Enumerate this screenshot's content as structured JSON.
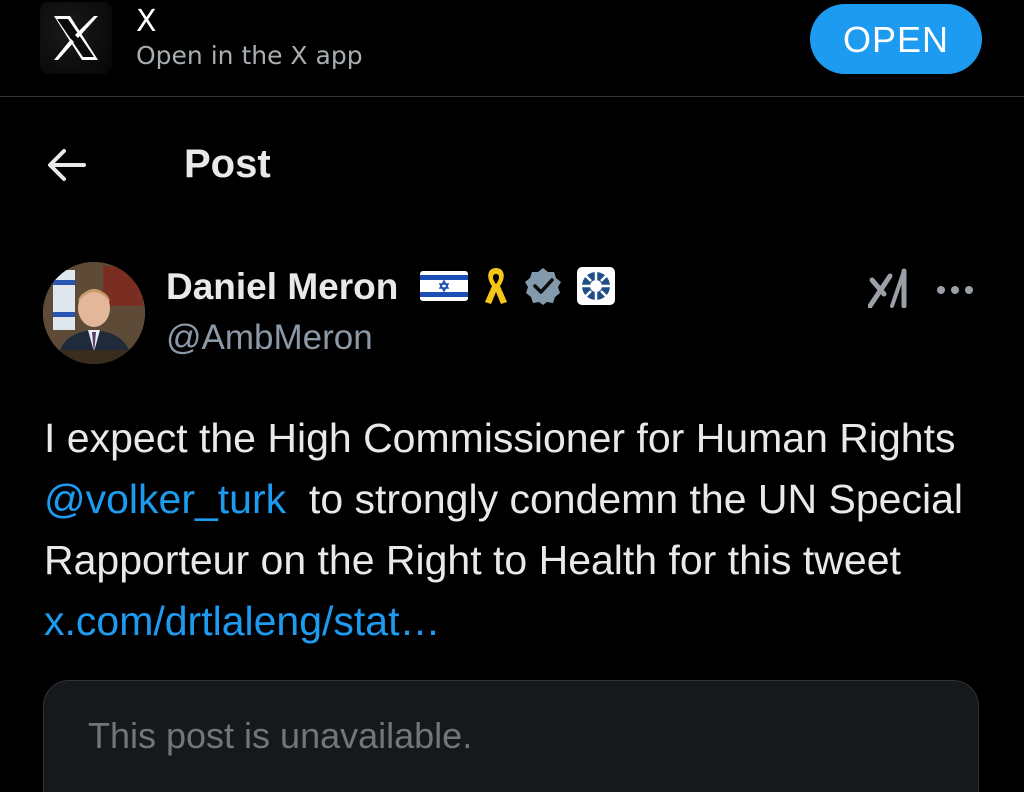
{
  "banner": {
    "app_name": "X",
    "subtitle": "Open in the X app",
    "open_label": "OPEN"
  },
  "header": {
    "title": "Post"
  },
  "author": {
    "name": "Daniel Meron",
    "handle": "@AmbMeron"
  },
  "post": {
    "text_1": "I expect the High Commissioner for Human Rights ",
    "mention": "@volker_turk",
    "text_2": "  to strongly condemn the UN Special Rapporteur on the Right to Health for this tweet ",
    "link": "x.com/drtlaleng/stat…"
  },
  "quoted": {
    "unavailable_text": "This post is unavailable."
  },
  "icons": {
    "app": "x-logo-icon",
    "back": "arrow-left-icon",
    "flag": "israel-flag-icon",
    "ribbon": "yellow-ribbon-icon",
    "verified": "verified-badge-icon",
    "affiliate": "affiliate-badge-icon",
    "grok": "grok-icon",
    "more": "more-icon"
  },
  "colors": {
    "background": "#000000",
    "accent": "#1d9bf0",
    "text": "#e7e9ea",
    "muted": "#8b98a5",
    "ribbon": "#f5c518"
  }
}
